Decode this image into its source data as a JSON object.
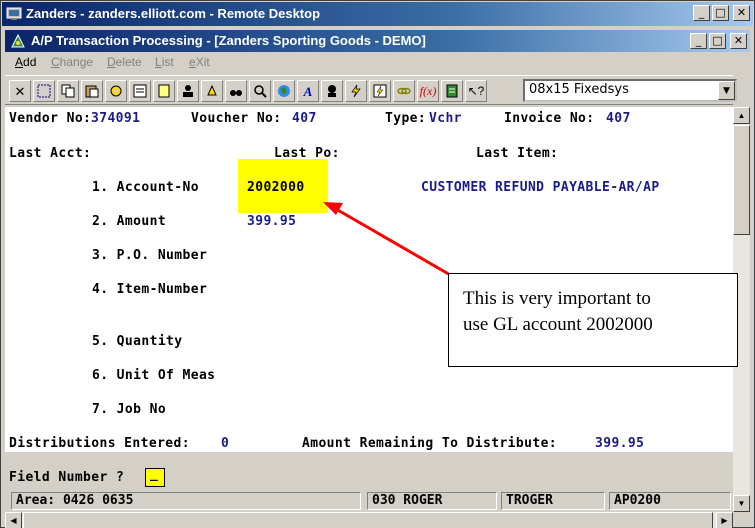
{
  "remote_desktop": {
    "title": "Zanders - zanders.elliott.com - Remote Desktop",
    "buttons": {
      "minimize": "_",
      "maximize": "□",
      "close": "✕"
    }
  },
  "app": {
    "title": "A/P Transaction Processing - [Zanders Sporting Goods - DEMO]",
    "buttons": {
      "minimize": "_",
      "maximize": "□",
      "close": "✕"
    }
  },
  "menu": {
    "items": [
      {
        "first": "A",
        "rest": "dd",
        "active": true
      },
      {
        "first": "C",
        "rest": "hange",
        "active": false
      },
      {
        "first": "D",
        "rest": "elete",
        "active": false
      },
      {
        "first": "L",
        "rest": "ist",
        "active": false
      },
      {
        "first": "e",
        "rest": "Xit",
        "active": false
      }
    ]
  },
  "toolbar": {
    "icons": [
      "close-x-icon",
      "select-icon",
      "copy-icon",
      "paste-icon",
      "gear-icon",
      "properties-icon",
      "note-icon",
      "user-icon",
      "bell-icon",
      "binoculars-icon",
      "search-icon",
      "globe-icon",
      "font-icon",
      "user-help-icon",
      "lightning-icon",
      "lightning-alt-icon",
      "link-icon",
      "function-icon",
      "database-icon",
      "help-pointer-icon"
    ],
    "font_select_value": "08x15 Fixedsys"
  },
  "terminal": {
    "vendor_label": "Vendor No:",
    "vendor_value": "374091",
    "voucher_label": "Voucher No:",
    "voucher_value": "407",
    "type_label": "Type:",
    "type_value": "Vchr",
    "invoice_label": "Invoice No:",
    "invoice_value": "407",
    "last_acct_label": "Last Acct:",
    "last_po_label": "Last Po:",
    "last_item_label": "Last Item:",
    "fields": [
      {
        "label": "1. Account-No",
        "value": "2002000",
        "desc": "CUSTOMER REFUND PAYABLE-AR/AP"
      },
      {
        "label": "2. Amount",
        "value": "399.95",
        "desc": ""
      },
      {
        "label": "3. P.O. Number",
        "value": "",
        "desc": ""
      },
      {
        "label": "4. Item-Number",
        "value": "",
        "desc": ""
      },
      {
        "label": "5. Quantity",
        "value": "",
        "desc": ""
      },
      {
        "label": "6. Unit Of Meas",
        "value": "",
        "desc": ""
      },
      {
        "label": "7. Job No",
        "value": "",
        "desc": ""
      }
    ],
    "distributions_label": "Distributions Entered:",
    "distributions_value": "0",
    "remaining_label": "Amount Remaining To Distribute:",
    "remaining_value": "399.95"
  },
  "prompt": {
    "label": "Field Number ?",
    "value": "_"
  },
  "statusbar": {
    "area": "Area: 0426 0635",
    "user_code": "030 ROGER",
    "user_name": "TROGER",
    "program": "AP0200"
  },
  "annotation": {
    "line1": "This is very important to",
    "line2": "use GL account 2002000"
  },
  "colors": {
    "titlebar_start": "#0a246a",
    "highlight": "#ffff00",
    "field_value": "#1a1a8a",
    "arrow": "#ff0000"
  }
}
